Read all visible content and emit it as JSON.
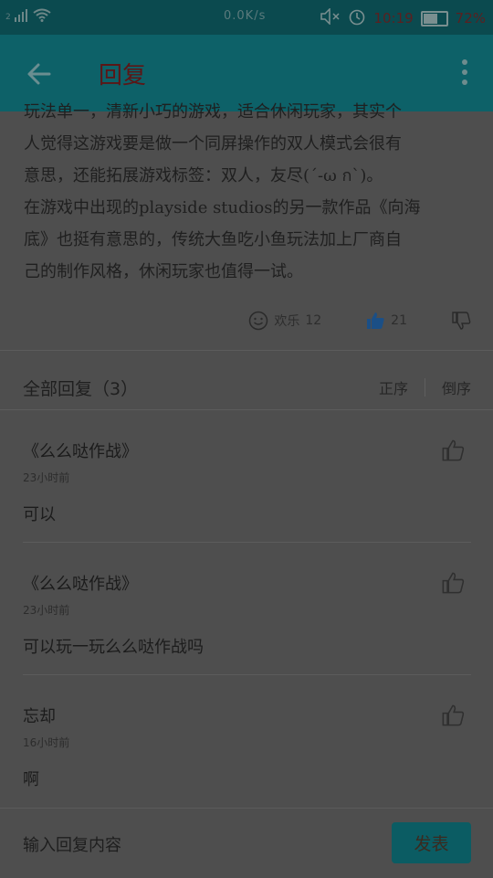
{
  "status_bar": {
    "sim": "2",
    "network_speed": "0.0K/s",
    "time": "10:19",
    "battery": "72%"
  },
  "app_bar": {
    "title": "回复"
  },
  "article": {
    "text": "玩法单一，清新小巧的游戏，适合休闲玩家，其实个\n人觉得这游戏要是做一个同屏操作的双人模式会很有\n意思，还能拓展游戏标签：双人，友尽(´-ω ก`)。\n在游戏中出现的playside studios的另一款作品《向海\n底》也挺有意思的，传统大鱼吃小鱼玩法加上厂商自\n己的制作风格，休闲玩家也值得一试。"
  },
  "reactions": {
    "happy_label": "欢乐",
    "happy_count": "12",
    "likes_count": "21"
  },
  "replies_section": {
    "header": "全部回复（3）",
    "sort_asc": "正序",
    "sort_desc": "倒序",
    "items": [
      {
        "user": "《么么哒作战》",
        "time": "23小时前",
        "text": "可以"
      },
      {
        "user": "《么么哒作战》",
        "time": "23小时前",
        "text": "可以玩一玩么么哒作战吗"
      },
      {
        "user": "忘却",
        "time": "16小时前",
        "text": "啊"
      }
    ]
  },
  "input_bar": {
    "placeholder": "输入回复内容",
    "send_label": "发表"
  },
  "colors": {
    "appbar": "#0d6168",
    "accent": "#0b5c63",
    "like_blue": "#1b4f86"
  }
}
